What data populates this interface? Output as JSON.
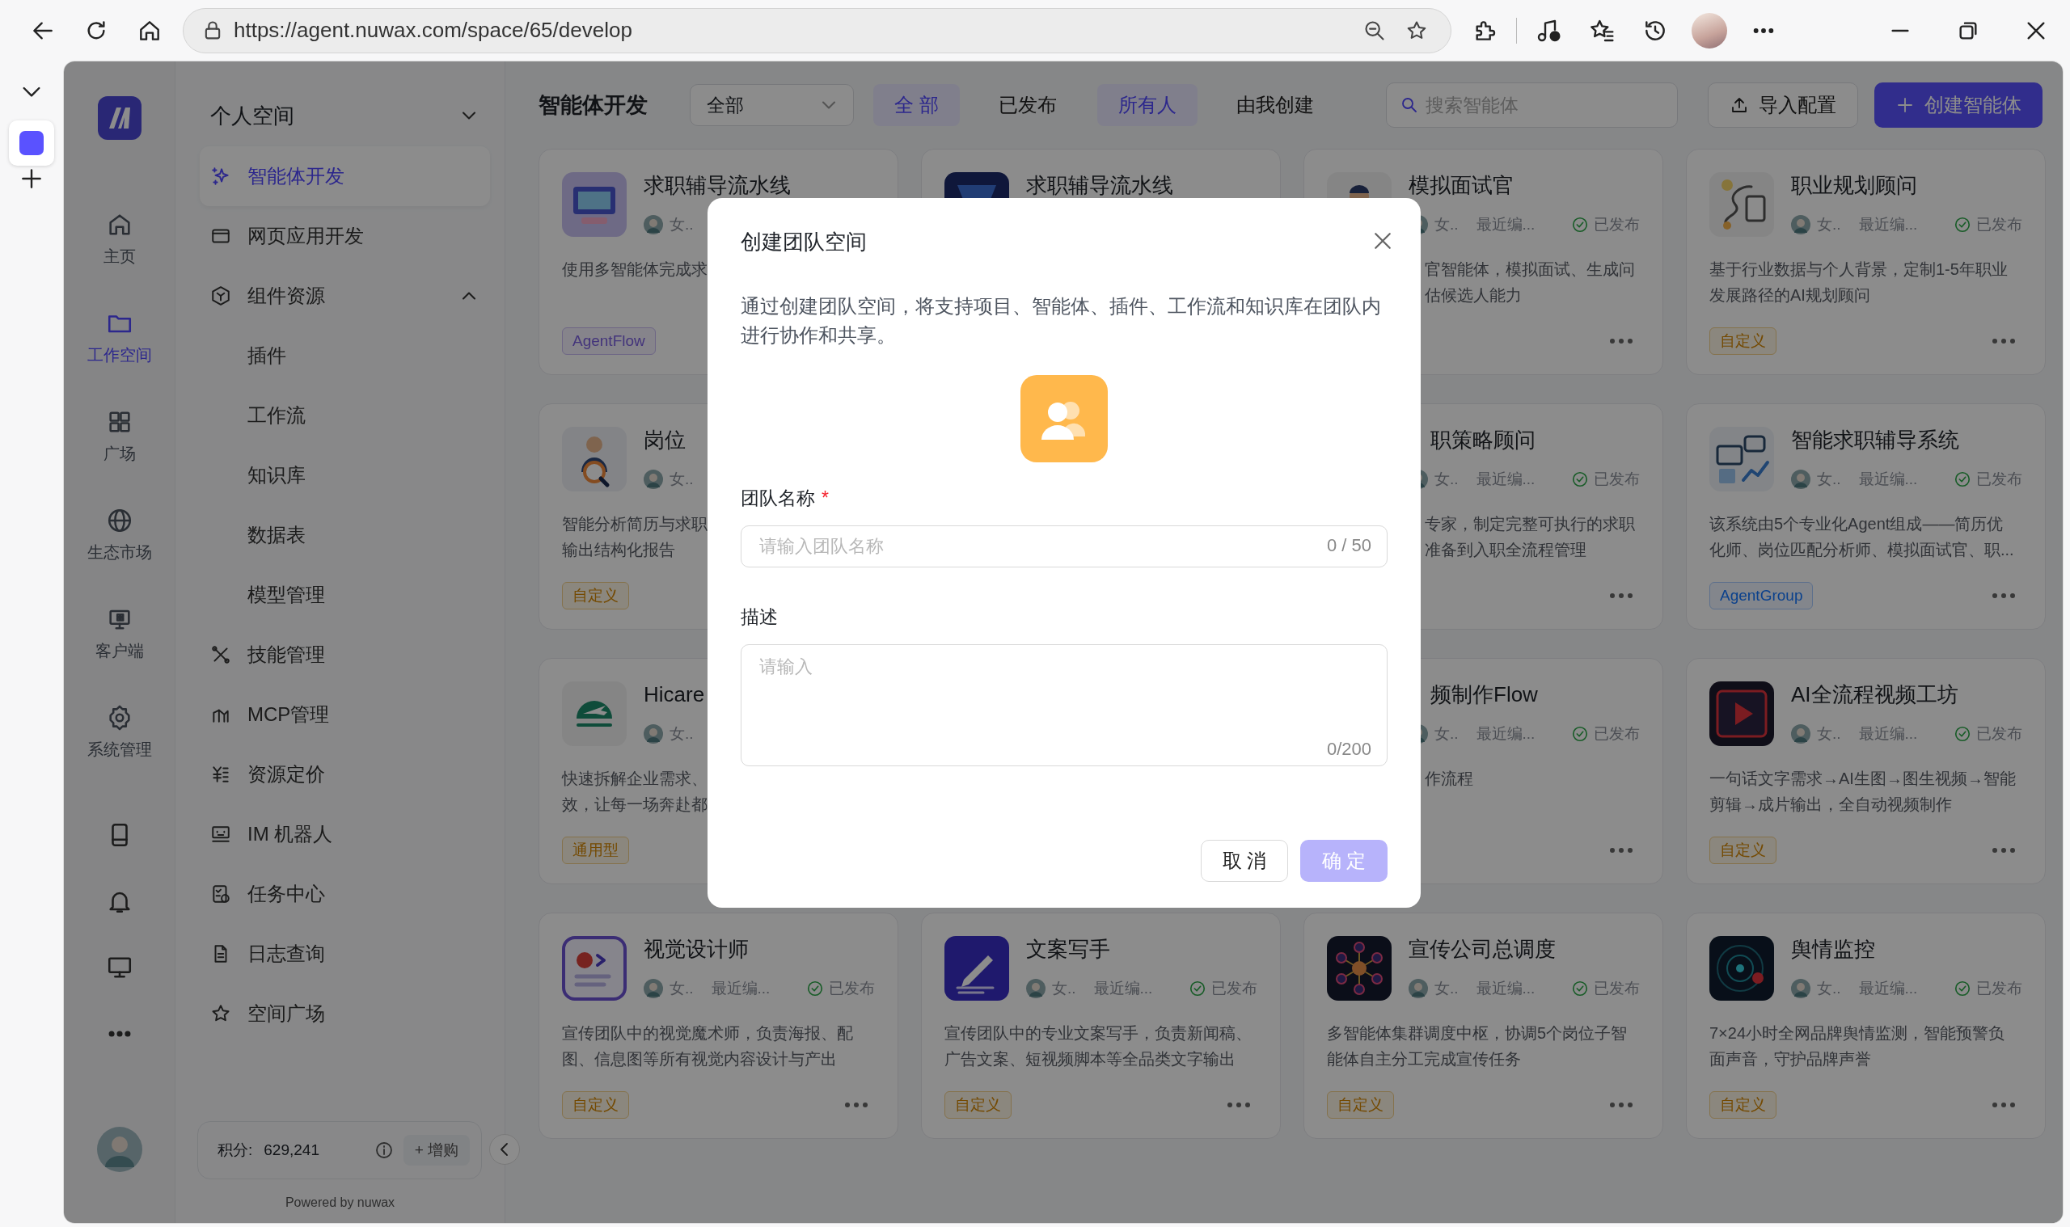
{
  "browser": {
    "url": "https://agent.nuwax.com/space/65/develop"
  },
  "rail": {
    "items": [
      {
        "label": "主页",
        "selected": false
      },
      {
        "label": "工作空间",
        "selected": true
      },
      {
        "label": "广场",
        "selected": false
      },
      {
        "label": "生态市场",
        "selected": false
      },
      {
        "label": "客户端",
        "selected": false
      },
      {
        "label": "系统管理",
        "selected": false
      }
    ]
  },
  "sidebar": {
    "space": "个人空间",
    "items": [
      {
        "label": "智能体开发",
        "selected": true
      },
      {
        "label": "网页应用开发",
        "selected": false
      },
      {
        "label": "组件资源",
        "selected": false,
        "expanded": true,
        "children": [
          {
            "label": "插件",
            "selected": false
          },
          {
            "label": "工作流",
            "selected": false
          },
          {
            "label": "知识库",
            "selected": false
          },
          {
            "label": "数据表",
            "selected": false
          },
          {
            "label": "模型管理",
            "selected": false
          }
        ]
      },
      {
        "label": "技能管理",
        "selected": false
      },
      {
        "label": "MCP管理",
        "selected": false
      },
      {
        "label": "资源定价",
        "selected": false
      },
      {
        "label": "IM 机器人",
        "selected": false
      },
      {
        "label": "任务中心",
        "selected": false
      },
      {
        "label": "日志查询",
        "selected": false
      },
      {
        "label": "空间广场",
        "selected": false
      }
    ],
    "points_label": "积分:",
    "points": "629,241",
    "buy": "+ 增购",
    "powered": "Powered by nuwax"
  },
  "header": {
    "title": "智能体开发",
    "select": "全部",
    "status_filters": [
      {
        "label": "全 部",
        "selected": true
      },
      {
        "label": "已发布",
        "selected": false
      }
    ],
    "creator_filters": [
      {
        "label": "所有人",
        "selected": true
      },
      {
        "label": "由我创建",
        "selected": false
      }
    ],
    "search_placeholder": "搜索智能体",
    "import": "导入配置",
    "create": "创建智能体"
  },
  "cards": [
    {
      "column_1": {
        "title": "求职辅导流水线",
        "author": "女..",
        "desc": "使用多智能体完成求",
        "tag": {
          "text": "AgentFlow",
          "kind": "flow"
        }
      },
      "column_2": {
        "title": "求职辅导流水线"
      },
      "column_3": {
        "title": "模拟面试官",
        "author": "女..",
        "edited": "最近编...",
        "status": "已发布",
        "desc": "官智能体，模拟面试、生成问估候选人能力"
      },
      "column_4": {
        "title": "职业规划顾问",
        "author": "女..",
        "edited": "最近编...",
        "status": "已发布",
        "desc": "基于行业数据与个人背景，定制1-5年职业发展路径的AI规划顾问",
        "tag": {
          "text": "自定义",
          "kind": "custom"
        }
      }
    },
    {
      "column_1": {
        "title": "岗位",
        "author": "女..",
        "desc": "智能分析简历与求职输出结构化报告",
        "tag": {
          "text": "自定义",
          "kind": "custom"
        }
      },
      "column_3": {
        "title": "职策略顾问",
        "author": "女..",
        "edited": "最近编...",
        "status": "已发布",
        "desc": "专家，制定完整可执行的求职准备到入职全流程管理"
      },
      "column_4": {
        "title": "智能求职辅导系统",
        "author": "女..",
        "edited": "最近编...",
        "status": "已发布",
        "desc": "该系统由5个专业化Agent组成——简历优化师、岗位匹配分析师、模拟面试官、职...",
        "tag": {
          "text": "AgentGroup",
          "kind": "group"
        }
      }
    },
    {
      "column_1": {
        "title": "Hicare",
        "author": "女..",
        "desc": "快速拆解企业需求、效，让每一场奔赴都",
        "tag": {
          "text": "通用型",
          "kind": "custom"
        }
      },
      "column_3": {
        "title": "频制作Flow",
        "author": "女..",
        "edited": "最近编...",
        "status": "已发布",
        "desc": "作流程"
      },
      "column_4": {
        "title": "AI全流程视频工坊",
        "author": "女..",
        "edited": "最近编...",
        "status": "已发布",
        "desc": "一句话文字需求→AI生图→图生视频→智能剪辑→成片输出，全自动视频制作",
        "tag": {
          "text": "自定义",
          "kind": "custom"
        }
      }
    },
    {
      "column_1": {
        "title": "视觉设计师",
        "author": "女..",
        "edited": "最近编...",
        "status": "已发布",
        "desc": "宣传团队中的视觉魔术师，负责海报、配图、信息图等所有视觉内容设计与产出",
        "tag": {
          "text": "自定义",
          "kind": "custom"
        }
      },
      "column_2": {
        "title": "文案写手",
        "author": "女..",
        "edited": "最近编...",
        "status": "已发布",
        "desc": "宣传团队中的专业文案写手，负责新闻稿、广告文案、短视频脚本等全品类文字输出",
        "tag": {
          "text": "自定义",
          "kind": "custom"
        }
      },
      "column_3": {
        "title": "宣传公司总调度",
        "author": "女..",
        "edited": "最近编...",
        "status": "已发布",
        "desc": "多智能体集群调度中枢，协调5个岗位子智能体自主分工完成宣传任务",
        "tag": {
          "text": "自定义",
          "kind": "custom"
        }
      },
      "column_4": {
        "title": "舆情监控",
        "author": "女..",
        "edited": "最近编...",
        "status": "已发布",
        "desc": "7×24小时全网品牌舆情监测，智能预警负面声音，守护品牌声誉",
        "tag": {
          "text": "自定义",
          "kind": "custom"
        }
      }
    }
  ],
  "dialog": {
    "title": "创建团队空间",
    "desc": "通过创建团队空间，将支持项目、智能体、插件、工作流和知识库在团队内进行协作和共享。",
    "name_label": "团队名称",
    "required_mark": "*",
    "name_placeholder": "请输入团队名称",
    "name_count": "0 / 50",
    "desc_label": "描述",
    "desc_placeholder": "请输入",
    "desc_count": "0/200",
    "cancel": "取 消",
    "ok": "确 定",
    "ok_disabled": true
  }
}
